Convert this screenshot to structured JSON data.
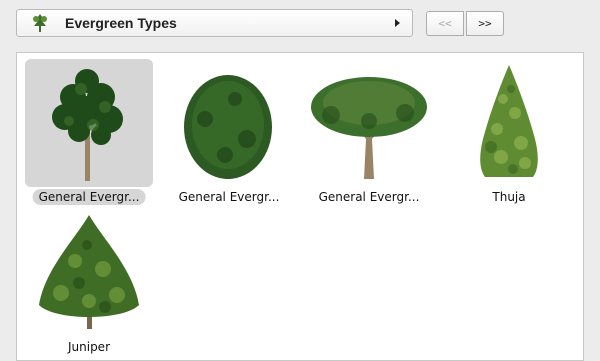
{
  "toolbar": {
    "category_icon": "tree-icon",
    "category_label": "Evergreen Types",
    "prev_label": "<<",
    "next_label": ">>"
  },
  "items": [
    {
      "label": "General Evergr...",
      "icon": "broadleaf-tree-icon",
      "selected": true
    },
    {
      "label": "General Evergr...",
      "icon": "bushy-conifer-icon",
      "selected": false
    },
    {
      "label": "General Evergr...",
      "icon": "wide-canopy-tree-icon",
      "selected": false
    },
    {
      "label": "Thuja",
      "icon": "thuja-icon",
      "selected": false
    },
    {
      "label": "Juniper",
      "icon": "juniper-icon",
      "selected": false
    }
  ],
  "colors": {
    "selection": "#d6d6d6",
    "foliage_dark": "#1f4a1a",
    "foliage_light": "#6f9a38",
    "trunk": "#8a7358"
  }
}
